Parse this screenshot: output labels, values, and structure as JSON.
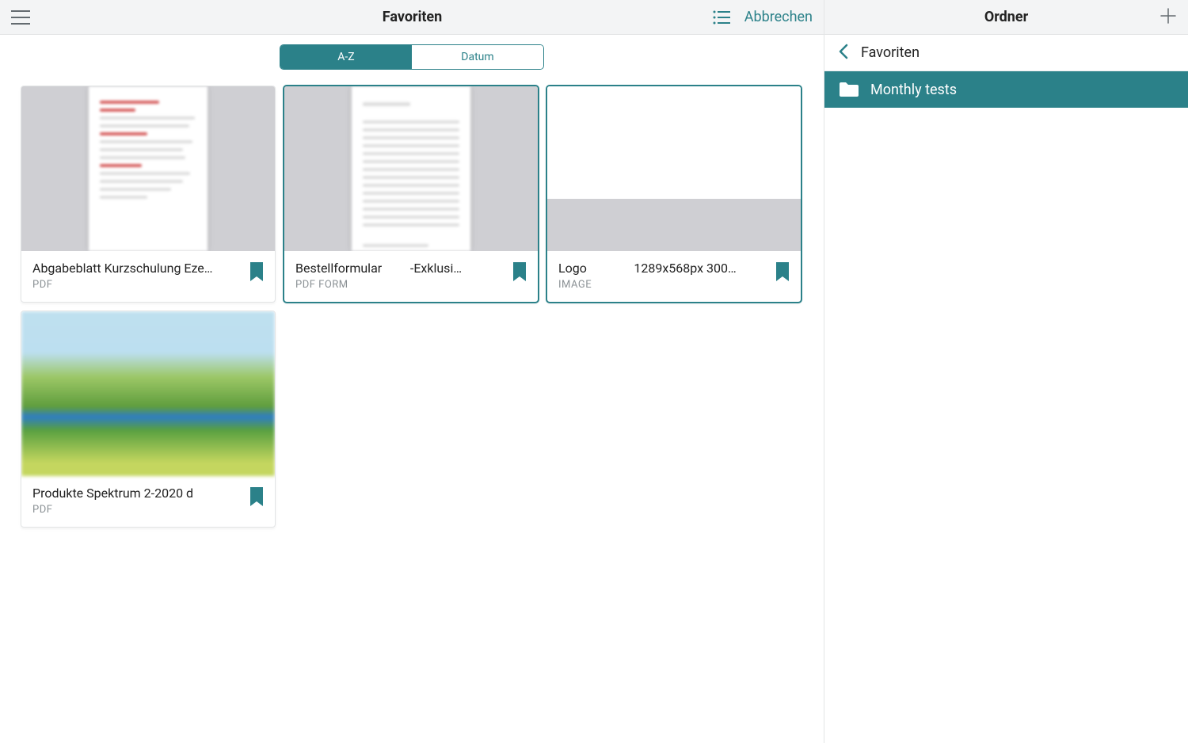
{
  "colors": {
    "accent": "#2b8189",
    "hamburger": "#646b70",
    "muted": "#8a9094"
  },
  "main": {
    "title": "Favoriten",
    "cancel_label": "Abbrechen",
    "segmented": {
      "active_index": 0,
      "options": [
        "A-Z",
        "Datum"
      ]
    }
  },
  "cards": [
    {
      "title_a": "Abgabeblatt Kurzschulung Eze…",
      "title_b": "",
      "type": "PDF",
      "thumb": "doc-red",
      "selected": false
    },
    {
      "title_a": "Bestellformular",
      "title_b": "-Exklusi…",
      "type": "PDF FORM",
      "thumb": "doc-table",
      "selected": true
    },
    {
      "title_a": "Logo",
      "title_b": "1289x568px 300…",
      "type": "IMAGE",
      "thumb": "logo",
      "selected": true
    },
    {
      "title_a": "Produkte Spektrum 2-2020 d",
      "title_b": "",
      "type": "PDF",
      "thumb": "photo",
      "selected": false
    }
  ],
  "side": {
    "title": "Ordner",
    "breadcrumb": "Favoriten",
    "folders": [
      {
        "label": "Monthly tests",
        "selected": true
      }
    ]
  }
}
